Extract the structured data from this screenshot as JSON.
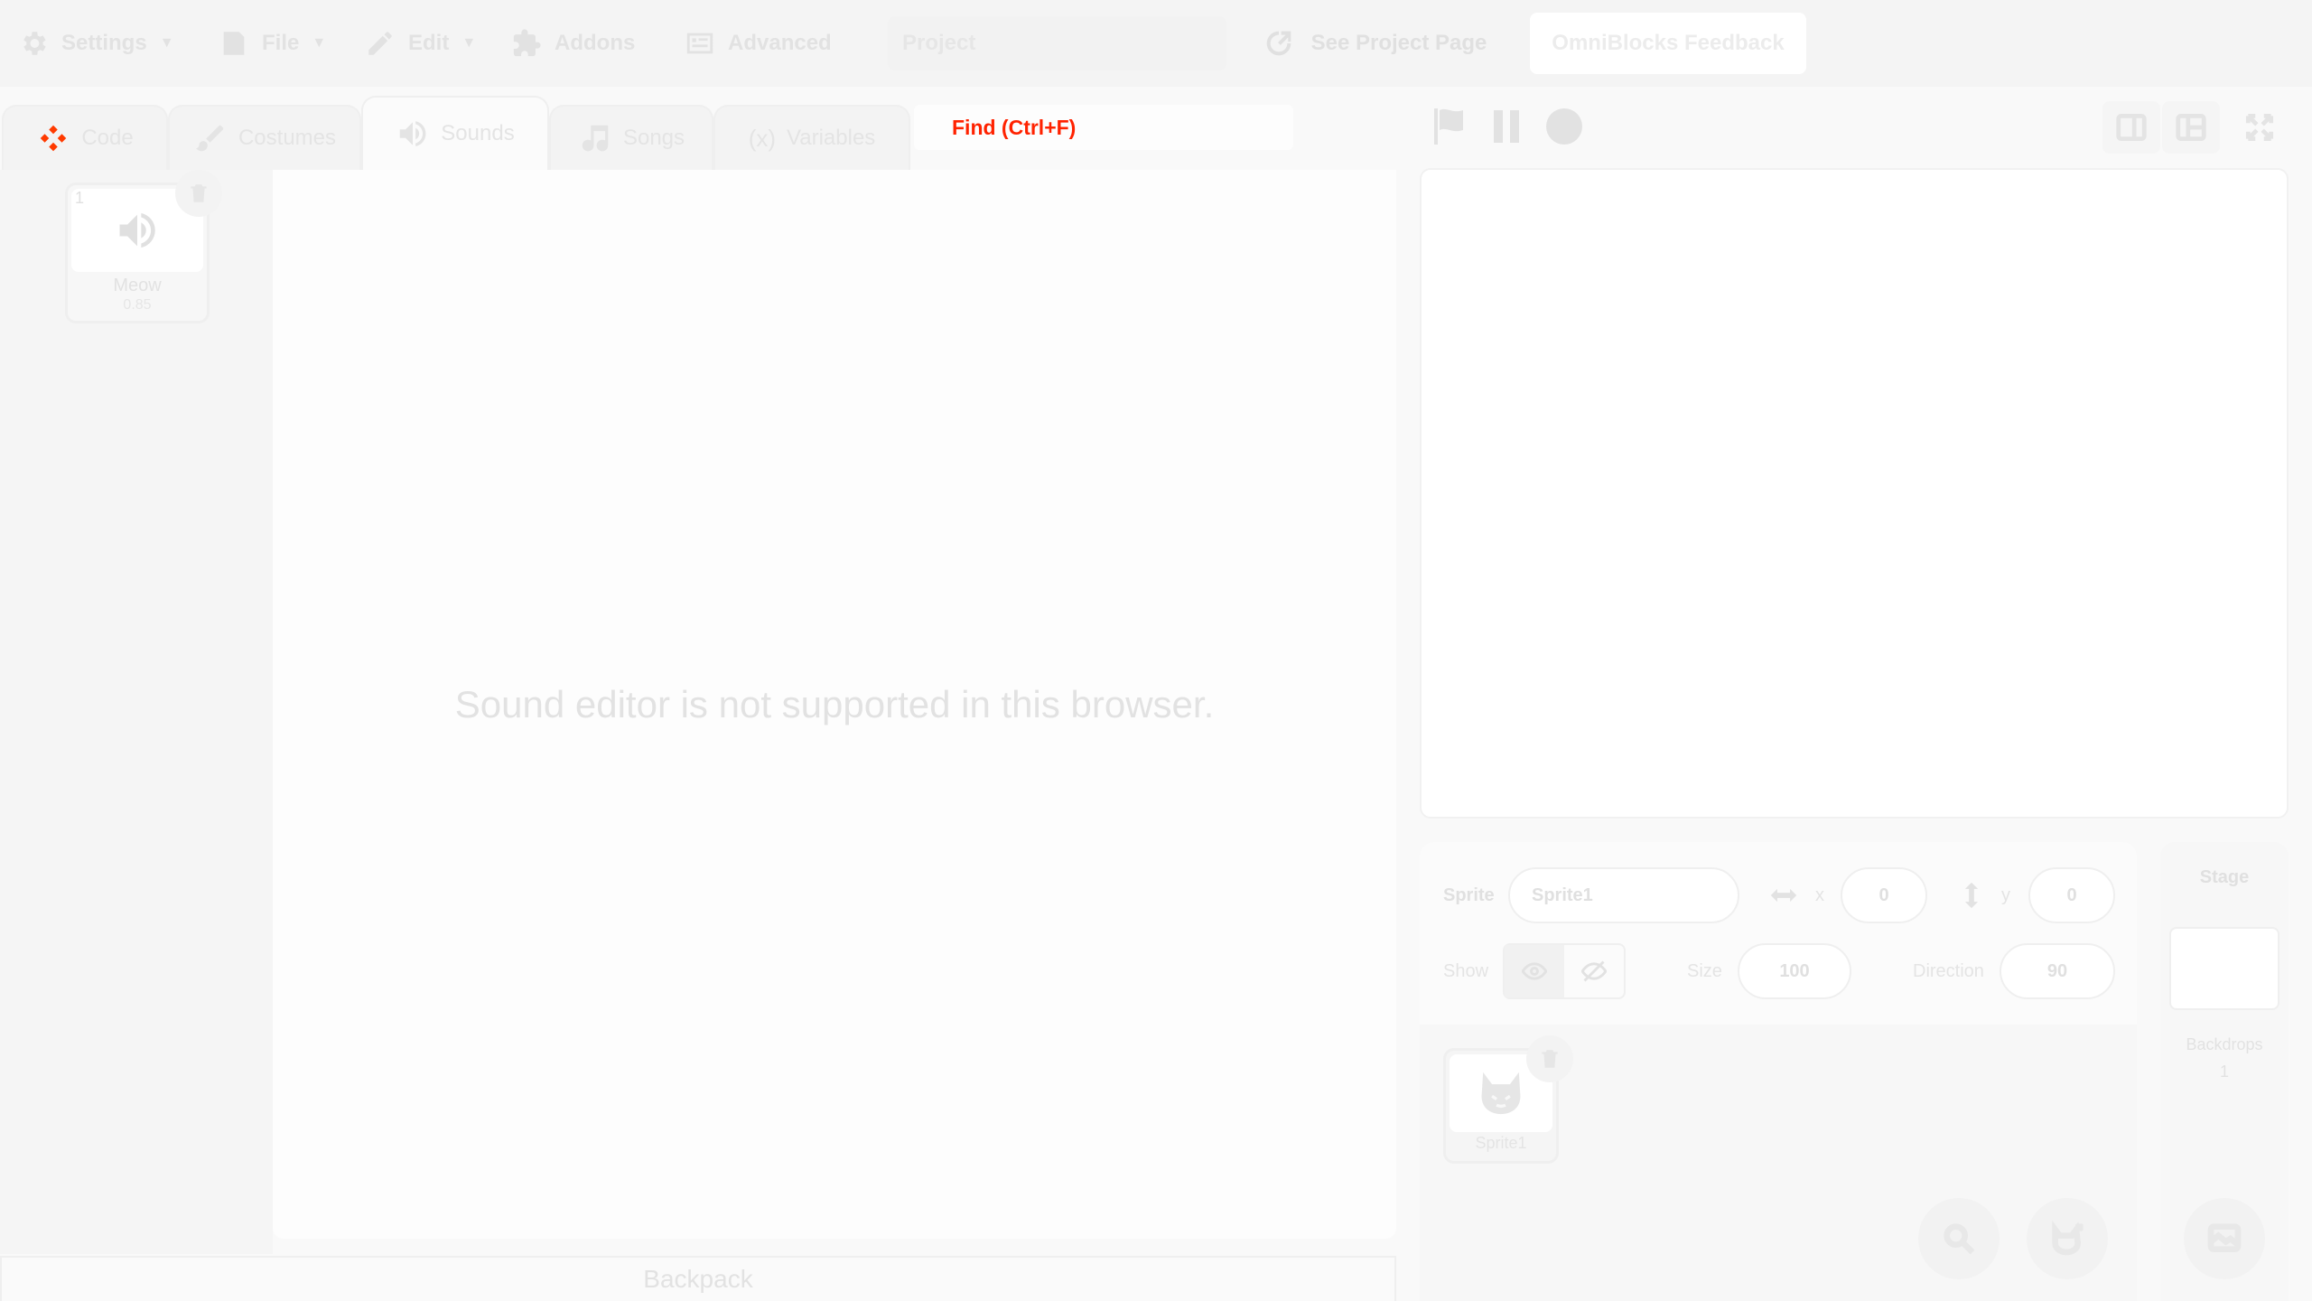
{
  "menu": {
    "settings": "Settings",
    "file": "File",
    "edit": "Edit",
    "addons": "Addons",
    "advanced": "Advanced",
    "project_title": "Project",
    "see_project_page": "See Project Page",
    "feedback": "OmniBlocks Feedback"
  },
  "tabs": [
    {
      "label": "Code",
      "icon": "code-blocks-icon"
    },
    {
      "label": "Costumes",
      "icon": "paintbrush-icon"
    },
    {
      "label": "Sounds",
      "icon": "speaker-icon",
      "active": true
    },
    {
      "label": "Songs",
      "icon": "music-note-icon"
    },
    {
      "label": "Variables",
      "icon": "variable-x-icon"
    }
  ],
  "find": {
    "label": "Find (Ctrl+F)",
    "color": "#ff2200"
  },
  "sounds": [
    {
      "index": "1",
      "name": "Meow",
      "duration": "0.85"
    }
  ],
  "editor": {
    "message": "Sound editor is not supported in this browser."
  },
  "backpack": {
    "label": "Backpack"
  },
  "sprite_info": {
    "sprite_label": "Sprite",
    "sprite_name": "Sprite1",
    "x_label": "x",
    "x_value": "0",
    "y_label": "y",
    "y_value": "0",
    "show_label": "Show",
    "size_label": "Size",
    "size_value": "100",
    "direction_label": "Direction",
    "direction_value": "90"
  },
  "sprites": [
    {
      "name": "Sprite1"
    }
  ],
  "stage_selector": {
    "title": "Stage",
    "backdrops_label": "Backdrops",
    "backdrops_count": "1"
  }
}
